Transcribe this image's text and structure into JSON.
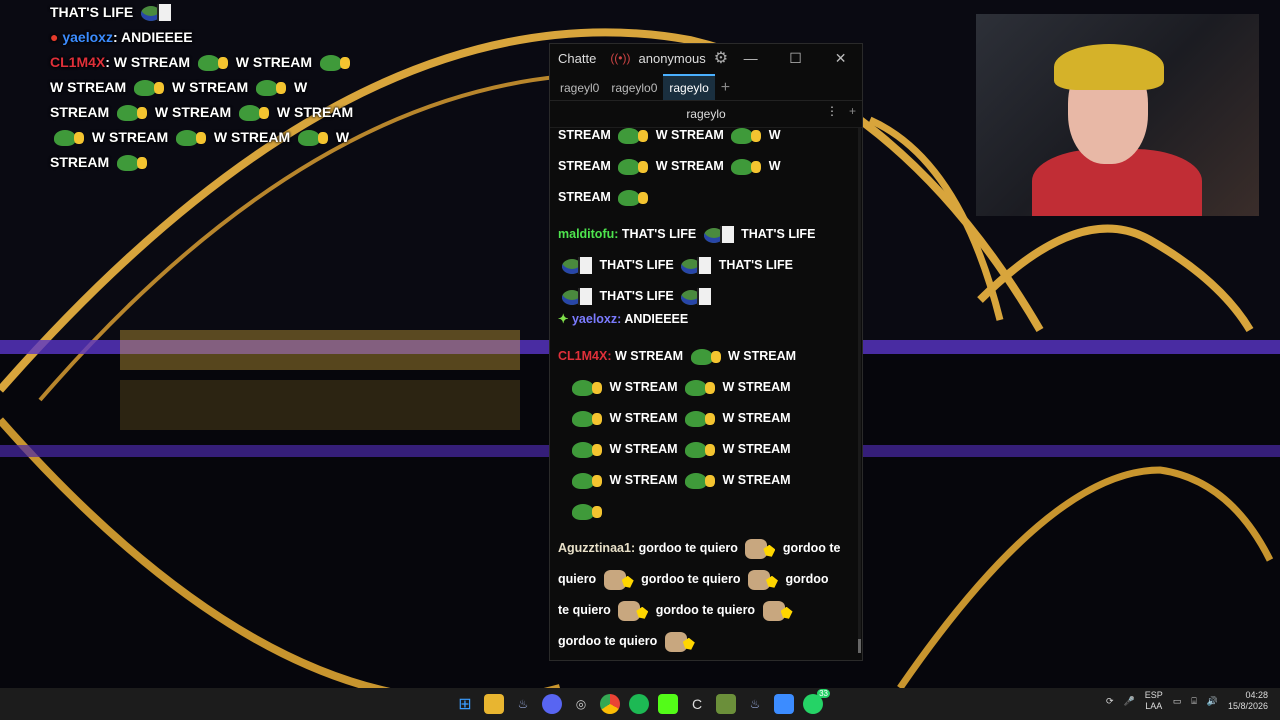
{
  "overlay_chat": {
    "line1": "THAT'S LIFE",
    "line2_name": "yaeloxz",
    "line2_text": ": ANDIEEEE",
    "line3_name": "CL1M4X",
    "line3_text": ": W STREAM",
    "w": "W STREAM",
    "w_part": "W",
    "stream": "STREAM"
  },
  "window": {
    "app_name": "Chatte",
    "user": "anonymous",
    "tabs": [
      "rageyl0",
      "rageylo0",
      "rageylo"
    ],
    "channel": "rageylo"
  },
  "messages": {
    "stream": "STREAM",
    "w_stream": "W STREAM",
    "w": "W",
    "malditofu_name": "malditofu",
    "life": "THAT'S LIFE",
    "yaeloxz_name": "yaeloxz",
    "yaeloxz_text": "ANDIEEEE",
    "climax_name": "CL1M4X",
    "agu_name": "Aguzztinaa1",
    "gordoo": "gordoo te quiero",
    "gordoo_a": "gordoo te",
    "gordoo_b": "quiero",
    "gordoo_c": "gordoo",
    "gordoo_d": "te quiero"
  },
  "colors": {
    "malditofu": "#4ee44e",
    "yaeloxz": "#7b7bff",
    "climax": "#e0303a",
    "aguzztinaa1": "#e8e0c8",
    "overlay_yaeloxz": "#3c8cff"
  },
  "taskbar": {
    "lang1": "ESP",
    "lang2": "LAA",
    "time": "04:28",
    "date": "15/8/2026",
    "badge": "33"
  }
}
